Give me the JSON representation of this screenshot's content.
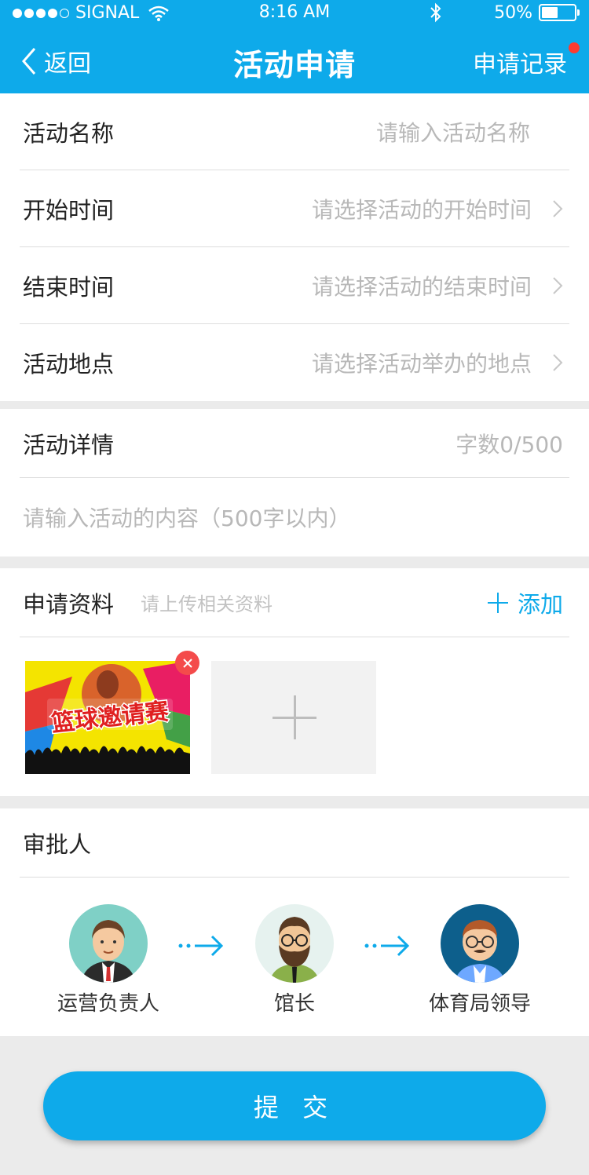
{
  "status_bar": {
    "carrier": "SIGNAL",
    "time": "8:16 AM",
    "battery": "50%",
    "battery_level": 0.5
  },
  "nav": {
    "back_label": "返回",
    "title": "活动申请",
    "records_label": "申请记录"
  },
  "form": {
    "rows": [
      {
        "label": "活动名称",
        "placeholder": "请输入活动名称"
      },
      {
        "label": "开始时间",
        "placeholder": "请选择活动的开始时间"
      },
      {
        "label": "结束时间",
        "placeholder": "请选择活动的结束时间"
      },
      {
        "label": "活动地点",
        "placeholder": "请选择活动举办的地点"
      }
    ]
  },
  "details": {
    "label": "活动详情",
    "count": "字数0/500",
    "placeholder": "请输入活动的内容（500字以内）"
  },
  "materials": {
    "label": "申请资料",
    "hint": "请上传相关资料",
    "add_label": "添加",
    "image_text": "篮球邀请赛"
  },
  "approvers": {
    "label": "审批人",
    "people": [
      {
        "name": "运营负责人"
      },
      {
        "name": "馆长"
      },
      {
        "name": "体育局领导"
      }
    ]
  },
  "submit_label": "提 交",
  "colors": {
    "primary": "#0eaaea",
    "badge": "#ff3b30",
    "remove": "#f44b4b"
  }
}
